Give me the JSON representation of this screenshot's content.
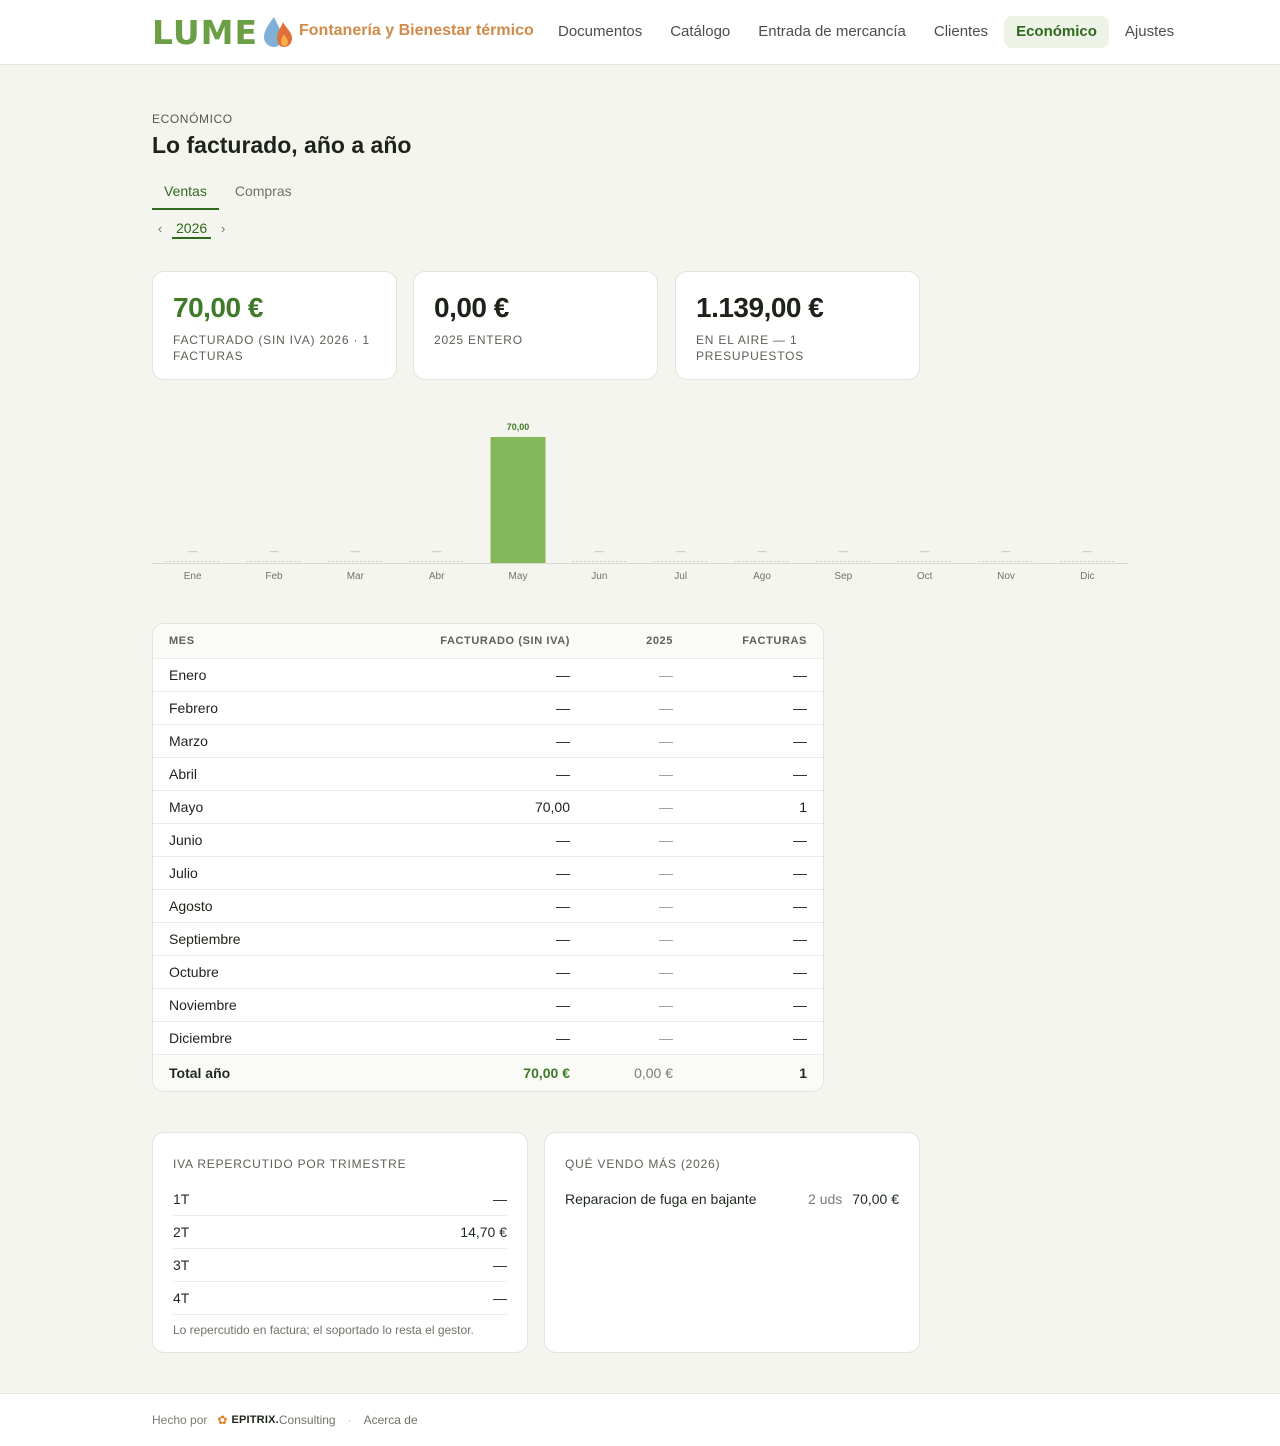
{
  "header": {
    "logo_text": "LUME",
    "tagline": "Fontanería y Bienestar térmico",
    "nav": [
      {
        "label": "Documentos"
      },
      {
        "label": "Catálogo"
      },
      {
        "label": "Entrada de mercancía"
      },
      {
        "label": "Clientes"
      },
      {
        "label": "Económico",
        "active": true
      },
      {
        "label": "Ajustes"
      }
    ]
  },
  "page": {
    "eyebrow": "ECONÓMICO",
    "title": "Lo facturado, año a año",
    "tabs": [
      {
        "label": "Ventas",
        "active": true
      },
      {
        "label": "Compras"
      }
    ],
    "year": "2026",
    "prev_arrow": "‹",
    "next_arrow": "›"
  },
  "stats": [
    {
      "value": "70,00 €",
      "label": "FACTURADO (SIN IVA) 2026 · 1 FACTURAS",
      "accent": "#3e7a27"
    },
    {
      "value": "0,00 €",
      "label": "2025 ENTERO"
    },
    {
      "value": "1.139,00 €",
      "label": "EN EL AIRE — 1 PRESUPUESTOS"
    }
  ],
  "chart_data": {
    "type": "bar",
    "categories": [
      "Ene",
      "Feb",
      "Mar",
      "Abr",
      "May",
      "Jun",
      "Jul",
      "Ago",
      "Sep",
      "Oct",
      "Nov",
      "Dic"
    ],
    "values": [
      null,
      null,
      null,
      null,
      70,
      null,
      null,
      null,
      null,
      null,
      null,
      null
    ],
    "data_labels": [
      "—",
      "—",
      "—",
      "—",
      "70,00",
      "—",
      "—",
      "—",
      "—",
      "—",
      "—",
      "—"
    ],
    "color": "#82b85a",
    "label_color": "#3e7a27",
    "grid": false
  },
  "table": {
    "headers": {
      "mes": "MES",
      "facturado": "FACTURADO (SIN IVA)",
      "prev": "2025",
      "facturas": "FACTURAS"
    },
    "rows": [
      {
        "mes": "Enero",
        "facturado": "—",
        "prev": "—",
        "facturas": "—"
      },
      {
        "mes": "Febrero",
        "facturado": "—",
        "prev": "—",
        "facturas": "—"
      },
      {
        "mes": "Marzo",
        "facturado": "—",
        "prev": "—",
        "facturas": "—"
      },
      {
        "mes": "Abril",
        "facturado": "—",
        "prev": "—",
        "facturas": "—"
      },
      {
        "mes": "Mayo",
        "facturado": "70,00",
        "prev": "—",
        "facturas": "1"
      },
      {
        "mes": "Junio",
        "facturado": "—",
        "prev": "—",
        "facturas": "—"
      },
      {
        "mes": "Julio",
        "facturado": "—",
        "prev": "—",
        "facturas": "—"
      },
      {
        "mes": "Agosto",
        "facturado": "—",
        "prev": "—",
        "facturas": "—"
      },
      {
        "mes": "Septiembre",
        "facturado": "—",
        "prev": "—",
        "facturas": "—"
      },
      {
        "mes": "Octubre",
        "facturado": "—",
        "prev": "—",
        "facturas": "—"
      },
      {
        "mes": "Noviembre",
        "facturado": "—",
        "prev": "—",
        "facturas": "—"
      },
      {
        "mes": "Diciembre",
        "facturado": "—",
        "prev": "—",
        "facturas": "—"
      }
    ],
    "total": {
      "mes": "Total año",
      "facturado": "70,00 €",
      "prev": "0,00 €",
      "facturas": "1"
    }
  },
  "iva": {
    "title": "IVA REPERCUTIDO POR TRIMESTRE",
    "rows": [
      {
        "label": "1T",
        "value": "—"
      },
      {
        "label": "2T",
        "value": "14,70 €"
      },
      {
        "label": "3T",
        "value": "—"
      },
      {
        "label": "4T",
        "value": "—"
      }
    ],
    "note": "Lo repercutido en factura; el soportado lo resta el gestor."
  },
  "top_products": {
    "title": "QUÉ VENDO MÁS (2026)",
    "items": [
      {
        "name": "Reparacion de fuga en bajante",
        "qty": "2 uds",
        "amount": "70,00 €"
      }
    ]
  },
  "footer": {
    "made_by": "Hecho por",
    "brand_bold": "EPITRIX.",
    "brand_light": "Consulting",
    "sep": "·",
    "about": "Acerca de"
  }
}
